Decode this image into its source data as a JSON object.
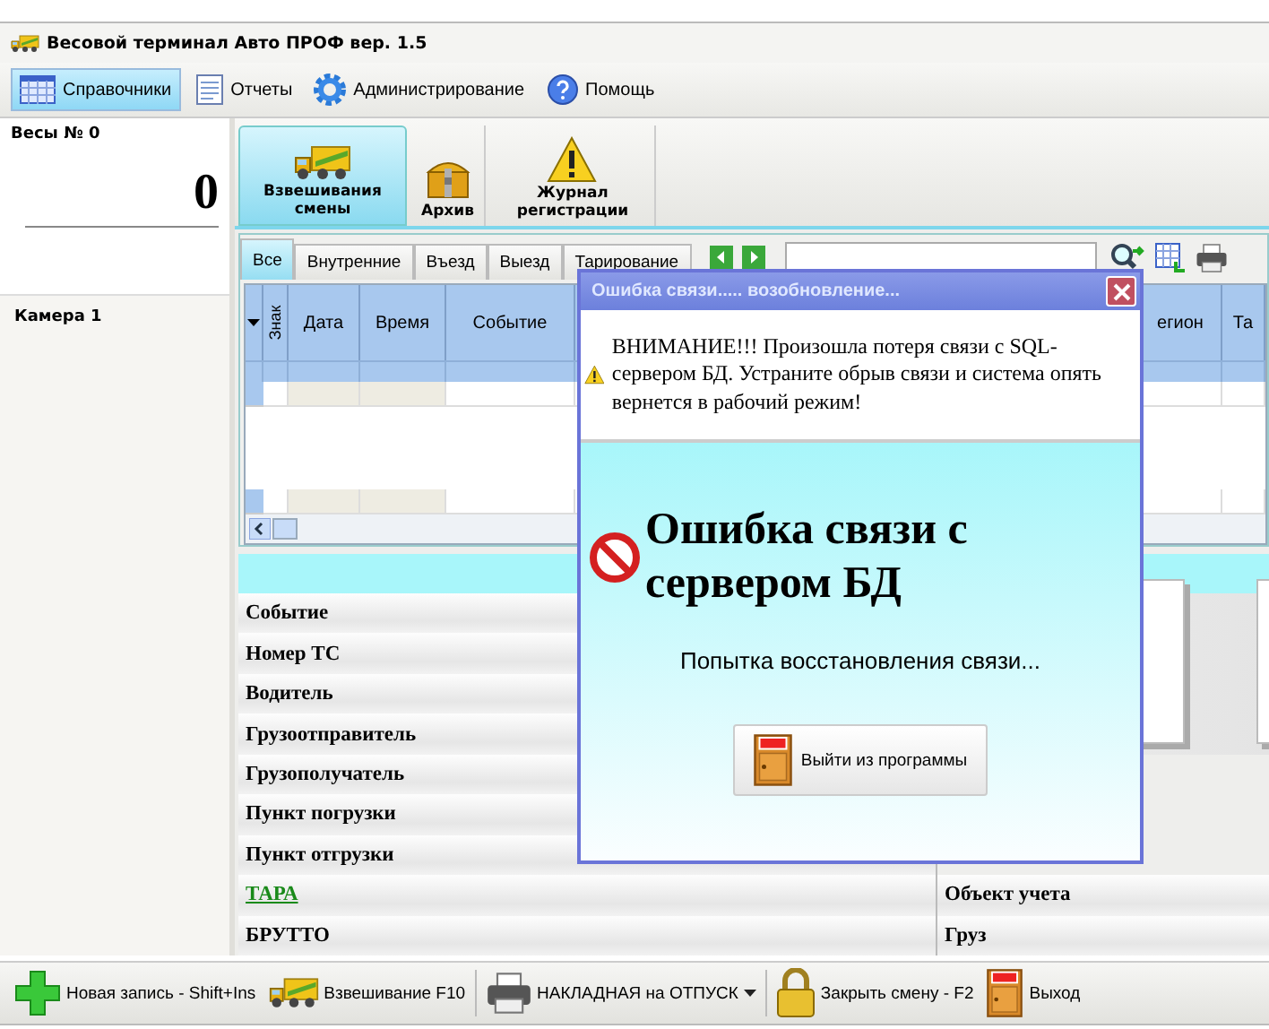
{
  "window": {
    "title": "Весовой терминал Авто ПРОФ вер. 1.5"
  },
  "menu": [
    {
      "label": "Справочники",
      "selected": true
    },
    {
      "label": "Отчеты",
      "selected": false
    },
    {
      "label": "Администрирование",
      "selected": false
    },
    {
      "label": "Помощь",
      "selected": false
    }
  ],
  "scale": {
    "title": "Весы № 0",
    "reading": "0"
  },
  "camera": {
    "title": "Камера 1"
  },
  "ribbon": [
    {
      "label": "Взвешивания смены",
      "selected": true
    },
    {
      "label": "Архив",
      "selected": false
    },
    {
      "label": "Журнал регистрации",
      "selected": false
    }
  ],
  "filter_tabs": [
    {
      "label": "Все",
      "selected": true
    },
    {
      "label": "Внутренние",
      "selected": false
    },
    {
      "label": "Въезд",
      "selected": false
    },
    {
      "label": "Выезд",
      "selected": false
    },
    {
      "label": "Тарирование",
      "selected": false
    }
  ],
  "grid": {
    "columns": [
      "Знак",
      "Дата",
      "Время",
      "Событие",
      "егион",
      "Та"
    ]
  },
  "details": {
    "left": [
      {
        "label": "Событие",
        "kind": "plain"
      },
      {
        "label": "Номер ТС",
        "kind": "plain"
      },
      {
        "label": "Водитель",
        "kind": "plain"
      },
      {
        "label": "Грузоотправитель",
        "kind": "plain"
      },
      {
        "label": "Грузополучатель",
        "kind": "plain"
      },
      {
        "label": "Пункт погрузки",
        "kind": "plain"
      },
      {
        "label": "Пункт отгрузки",
        "kind": "plain"
      },
      {
        "label": "ТАРА",
        "kind": "link"
      },
      {
        "label": "БРУТТО",
        "kind": "plain"
      }
    ],
    "right": [
      "Объект учета",
      "Груз"
    ]
  },
  "dialog": {
    "title": "Ошибка связи..... возобновление...",
    "warning": "ВНИМАНИЕ!!! Произошла потеря связи  с SQL-сервером БД. Устраните обрыв связи и система опять вернется в рабочий режим!",
    "error": "Ошибка связи с сервером БД",
    "status": "Попытка восстановления связи...",
    "button": "Выйти из программы"
  },
  "toolbar": [
    {
      "label": "Новая запись - Shift+Ins",
      "dropdown": false
    },
    {
      "label": "Взвешивание F10",
      "dropdown": false
    },
    {
      "label": "НАКЛАДНАЯ на ОТПУСК",
      "dropdown": true
    },
    {
      "label": "Закрыть смену - F2",
      "dropdown": false
    },
    {
      "label": "Выход",
      "dropdown": false
    }
  ]
}
